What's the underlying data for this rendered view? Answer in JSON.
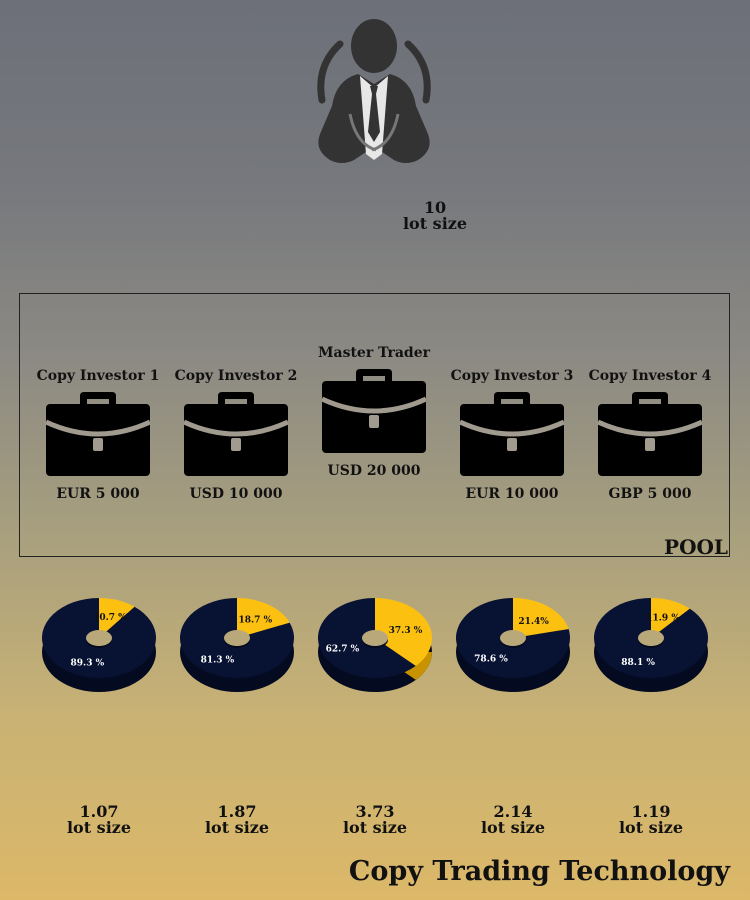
{
  "trader_lot": {
    "value": "10",
    "unit": "lot size"
  },
  "pool_label": "POOL",
  "accounts": [
    {
      "name": "Copy Investor 1",
      "amount": "EUR  5 000"
    },
    {
      "name": "Copy Investor 2",
      "amount": "USD  10 000"
    },
    {
      "name": "Master Trader",
      "amount": "USD  20 000"
    },
    {
      "name": "Copy Investor 3",
      "amount": "EUR  10 000"
    },
    {
      "name": "Copy Investor 4",
      "amount": "GBP  5 000"
    }
  ],
  "chart_data": [
    {
      "type": "pie",
      "labels": [
        "10.7 %",
        "89.3 %"
      ],
      "values": [
        10.7,
        89.3
      ]
    },
    {
      "type": "pie",
      "labels": [
        "18.7 %",
        "81.3 %"
      ],
      "values": [
        18.7,
        81.3
      ]
    },
    {
      "type": "pie",
      "labels": [
        "37.3 %",
        "62.7 %"
      ],
      "values": [
        37.3,
        62.7
      ]
    },
    {
      "type": "pie",
      "labels": [
        "21.4%",
        "78.6 %"
      ],
      "values": [
        21.4,
        78.6
      ]
    },
    {
      "type": "pie",
      "labels": [
        "11.9 %",
        "88.1 %"
      ],
      "values": [
        11.9,
        88.1
      ]
    }
  ],
  "lots": [
    {
      "value": "1.07",
      "unit": "lot size"
    },
    {
      "value": "1.87",
      "unit": "lot size"
    },
    {
      "value": "3.73",
      "unit": "lot size"
    },
    {
      "value": "2.14",
      "unit": "lot size"
    },
    {
      "value": "1.19",
      "unit": "lot size"
    }
  ],
  "footer_title": "Copy Trading Technology",
  "colors": {
    "navy": "#081233",
    "yellow": "#fcc011",
    "yellow_side": "#c99300",
    "navy_side": "#040a1f",
    "icon_gray": "#333333",
    "case_band": "#a09a8f"
  },
  "icons": {
    "trader": "businessman-icon",
    "account": "briefcase-icon"
  }
}
